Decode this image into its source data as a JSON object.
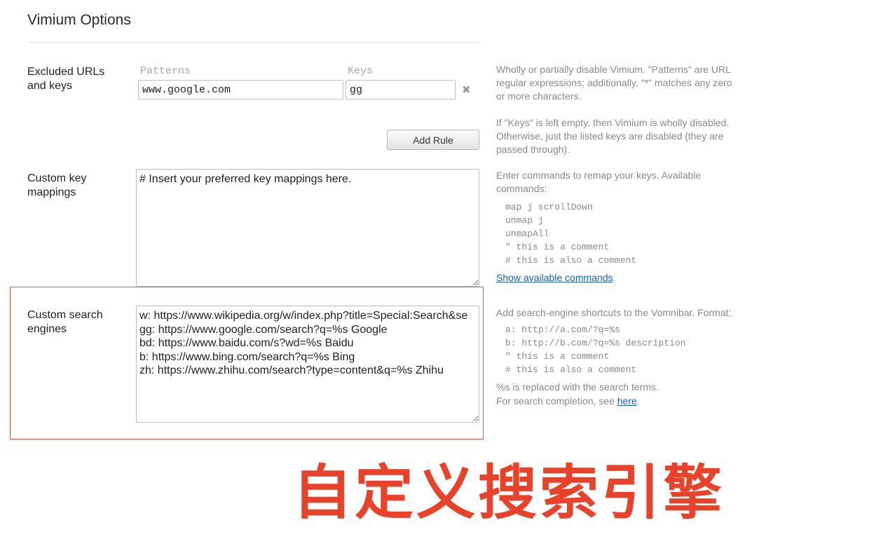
{
  "page": {
    "title": "Vimium Options"
  },
  "excluded": {
    "label_line1": "Excluded URLs",
    "label_line2": "and keys",
    "patterns_header": "Patterns",
    "keys_header": "Keys",
    "rule": {
      "pattern": "www.google.com",
      "keys": "gg"
    },
    "remove_glyph": "✖",
    "add_rule_label": "Add Rule",
    "help1": "Wholly or partially disable Vimium. \"Patterns\" are URL regular expressions; additionally, \"*\" matches any zero or more characters.",
    "help2": "If \"Keys\" is left empty, then Vimium is wholly disabled. Otherwise, just the listed keys are disabled (they are passed through)."
  },
  "key_mappings": {
    "label_line1": "Custom key",
    "label_line2": "mappings",
    "value": "# Insert your preferred key mappings here.",
    "help": "Enter commands to remap your keys. Available commands:",
    "examples": "map j scrollDown\nunmap j\nunmapAll\n\" this is a comment\n# this is also a comment",
    "show_commands_link": "Show available commands",
    "link_suffix": "."
  },
  "search_engines": {
    "label_line1": "Custom search",
    "label_line2": "engines",
    "value": "w: https://www.wikipedia.org/w/index.php?title=Special:Search&se\ngg: https://www.google.com/search?q=%s Google\nbd: https://www.baidu.com/s?wd=%s Baidu\nb: https://www.bing.com/search?q=%s Bing\nzh: https://www.zhihu.com/search?type=content&q=%s Zhihu",
    "help": "Add search-engine shortcuts to the Vomnibar. Format:",
    "examples": "a: http://a.com/?q=%s\nb: http://b.com/?q=%s description\n\" this is a comment\n# this is also a comment",
    "note1": "%s is replaced with the search terms.",
    "note2_prefix": "For search completion, see ",
    "here_link": "here",
    "note2_suffix": "."
  },
  "annotation": {
    "text": "自定义搜索引擎",
    "color": "#e8432a",
    "box_color": "#e9553a"
  }
}
